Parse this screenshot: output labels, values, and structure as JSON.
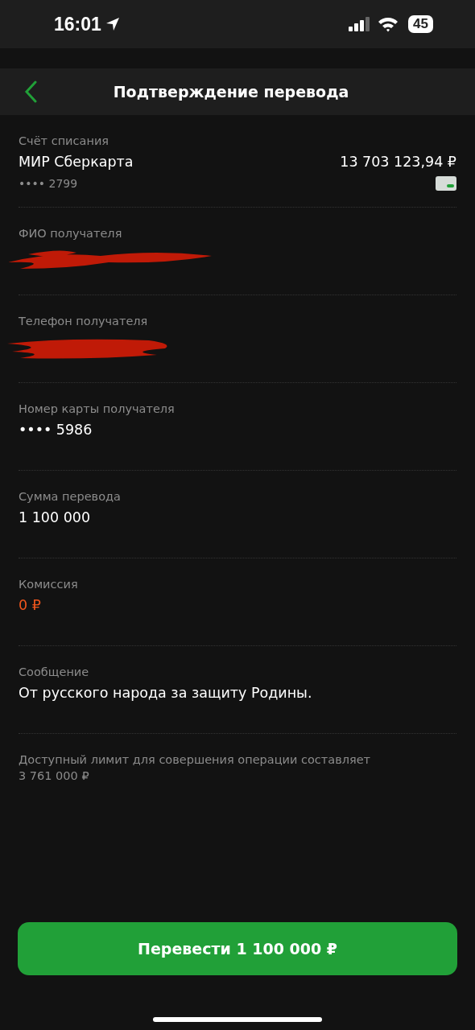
{
  "status_bar": {
    "time": "16:01",
    "battery": "45"
  },
  "header": {
    "title": "Подтверждение перевода"
  },
  "fields": [
    {
      "kind": "account",
      "label": "Счёт списания",
      "value": "МИР Сберкарта",
      "sub": "•••• 2799",
      "balance": "13 703 123,94 ₽"
    },
    {
      "kind": "redacted",
      "label": "ФИО получателя"
    },
    {
      "kind": "redacted",
      "label": "Телефон получателя"
    },
    {
      "kind": "plain",
      "label": "Номер карты получателя",
      "value": "•••• 5986"
    },
    {
      "kind": "plain",
      "label": "Сумма перевода",
      "value": "1 100 000"
    },
    {
      "kind": "fee",
      "label": "Комиссия",
      "value": "0 ₽"
    },
    {
      "kind": "plain",
      "label": "Сообщение",
      "value": "От русского народа за защиту Родины."
    }
  ],
  "limit_note": {
    "text": "Доступный лимит для совершения операции составляет",
    "amount": "3 761 000 ₽"
  },
  "submit_button": "Перевести 1 100 000 ₽"
}
